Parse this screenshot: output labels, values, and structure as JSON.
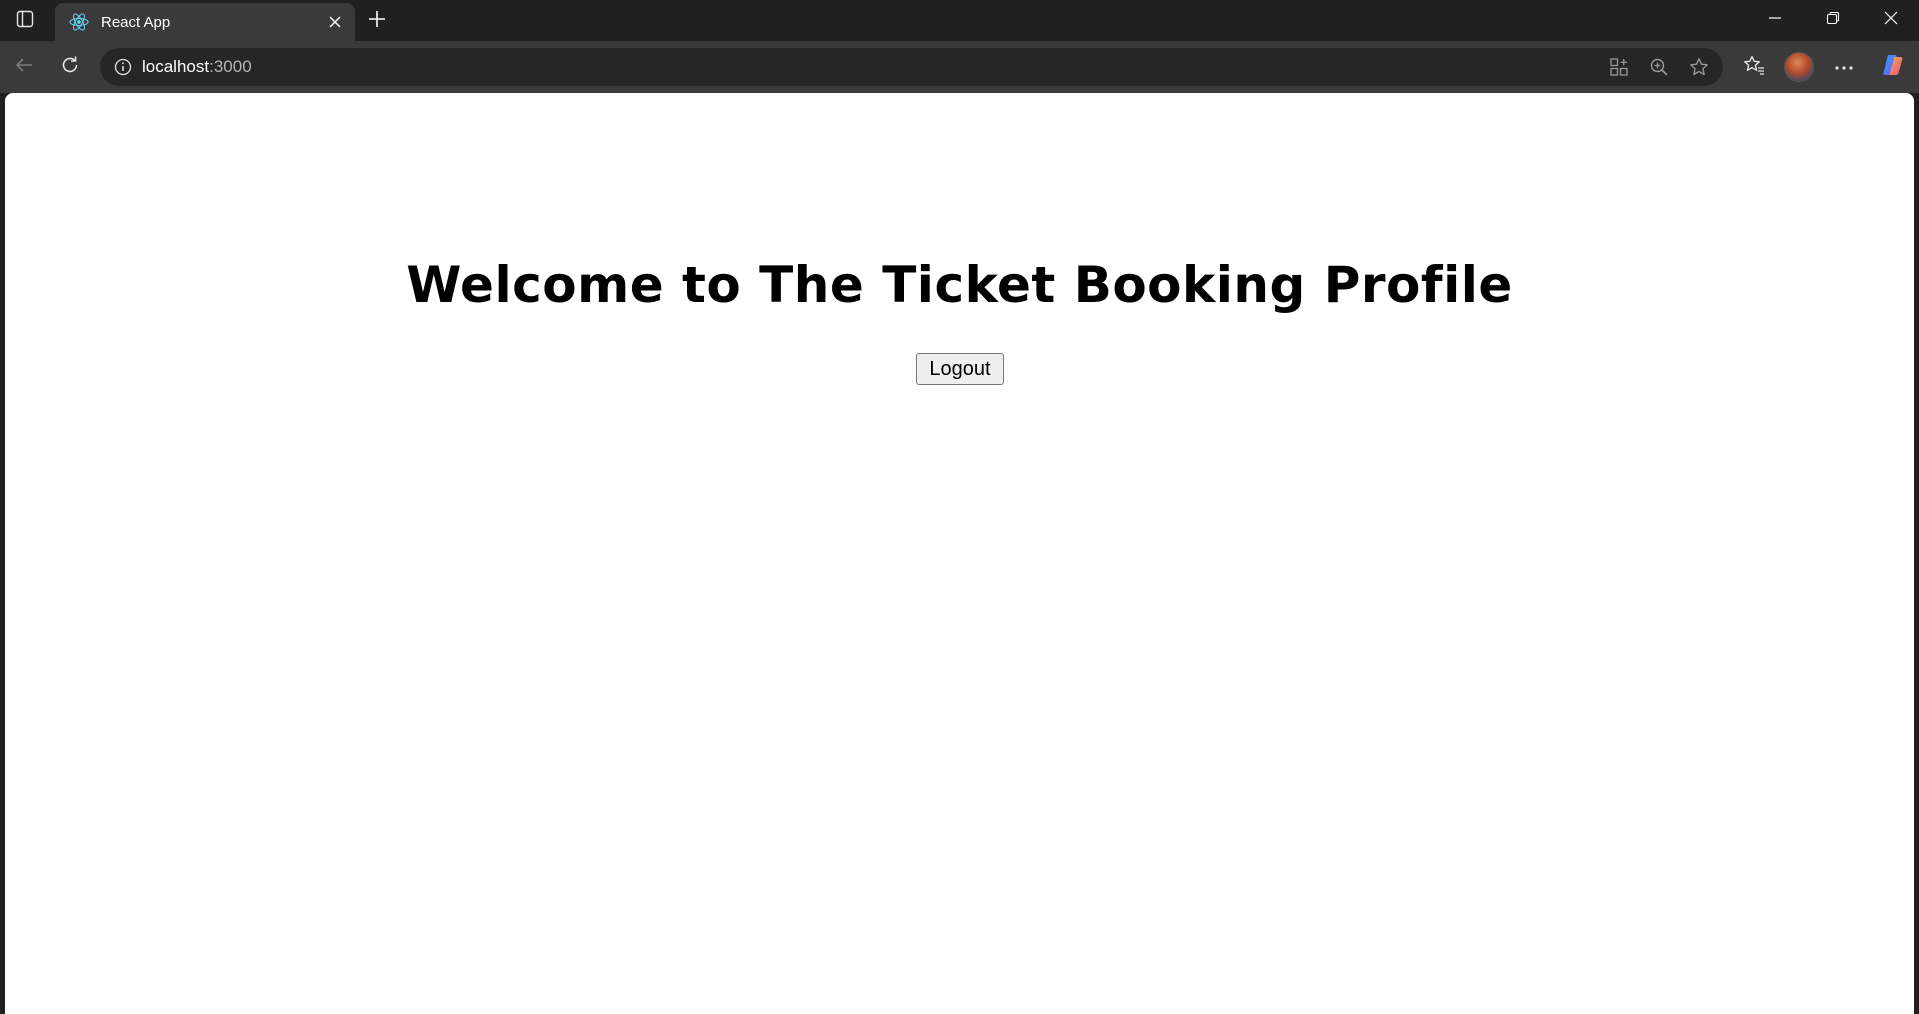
{
  "browser": {
    "tab": {
      "title": "React App",
      "favicon": "react-logo-icon"
    },
    "address_bar": {
      "host": "localhost",
      "port": ":3000"
    },
    "icons": {
      "tab_actions": "tab-actions-icon",
      "close_tab": "close-icon",
      "new_tab": "plus-icon",
      "back": "back-arrow-icon",
      "reload": "reload-icon",
      "site_info": "info-icon",
      "app_available": "app-install-icon",
      "zoom": "zoom-icon",
      "favorite": "star-icon",
      "favorites": "favorites-icon",
      "profile": "avatar",
      "more": "more-icon",
      "copilot": "copilot-icon",
      "minimize": "minimize-icon",
      "restore": "restore-icon",
      "close_window": "close-window-icon"
    },
    "colors": {
      "tab_strip": "#202020",
      "toolbar": "#3a3a3a",
      "omnibox": "#262626",
      "react_blue": "#61dafb"
    }
  },
  "page": {
    "heading": "Welcome to The Ticket Booking Profile",
    "logout_label": "Logout",
    "background": "#ffffff"
  }
}
